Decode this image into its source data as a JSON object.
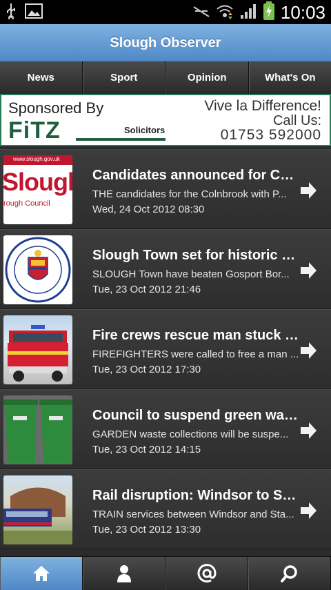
{
  "status_bar": {
    "time": "10:03"
  },
  "header": {
    "title": "Slough Observer"
  },
  "tabs": [
    "News",
    "Sport",
    "Opinion",
    "What's On"
  ],
  "banner": {
    "sponsored_by": "Sponsored By",
    "brand": "FiTZ",
    "solicitors": "Solicitors",
    "slogan": "Vive la Difference!",
    "call_us": "Call Us:",
    "phone": "01753 592000"
  },
  "articles": [
    {
      "title": "Candidates announced for Col...",
      "summary": "THE candidates for the Colnbrook with P...",
      "date": "Wed, 24 Oct 2012 08:30",
      "thumb_icon": "slough-council-logo",
      "thumb_url_text": "www.slough.gov.uk",
      "thumb_word": "Slough",
      "thumb_sub": "rough Council"
    },
    {
      "title": "Slough Town set for historic F...",
      "summary": "SLOUGH Town have beaten Gosport Bor...",
      "date": "Tue, 23 Oct 2012 21:46",
      "thumb_icon": "slough-town-fc-crest"
    },
    {
      "title": "Fire crews rescue man stuck i...",
      "summary": "FIREFIGHTERS were called to free a man ...",
      "date": "Tue, 23 Oct 2012 17:30",
      "thumb_icon": "fire-engine-photo"
    },
    {
      "title": "Council to suspend green was...",
      "summary": "GARDEN waste collections will be suspe...",
      "date": "Tue, 23 Oct 2012 14:15",
      "thumb_icon": "green-bins-photo"
    },
    {
      "title": "Rail disruption: Windsor to Sta...",
      "summary": "TRAIN services between Windsor and Sta...",
      "date": "Tue, 23 Oct 2012 13:30",
      "thumb_icon": "train-photo"
    }
  ],
  "bottom_nav": [
    {
      "icon": "home-icon",
      "active": true
    },
    {
      "icon": "person-icon",
      "active": false
    },
    {
      "icon": "at-icon",
      "active": false
    },
    {
      "icon": "search-icon",
      "active": false
    }
  ]
}
